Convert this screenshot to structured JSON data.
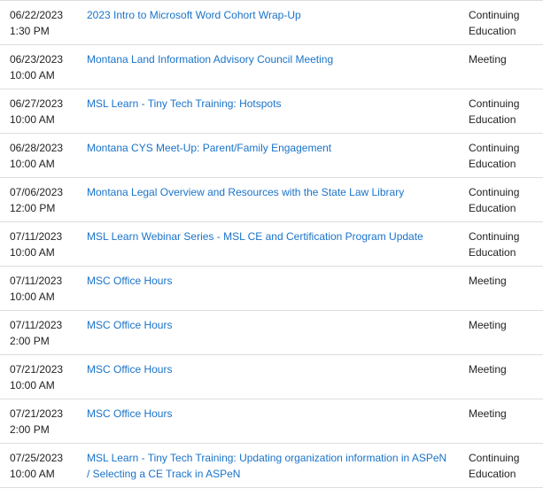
{
  "events": [
    {
      "date": "06/22/2023",
      "time": "1:30 PM",
      "title": "2023 Intro to Microsoft Word Cohort Wrap-Up",
      "type": "Continuing Education"
    },
    {
      "date": "06/23/2023",
      "time": "10:00 AM",
      "title": "Montana Land Information Advisory Council Meeting",
      "type": "Meeting"
    },
    {
      "date": "06/27/2023",
      "time": "10:00 AM",
      "title": "MSL Learn - Tiny Tech Training: Hotspots",
      "type": "Continuing Education"
    },
    {
      "date": "06/28/2023",
      "time": "10:00 AM",
      "title": "Montana CYS Meet-Up: Parent/Family Engagement",
      "type": "Continuing Education"
    },
    {
      "date": "07/06/2023",
      "time": "12:00 PM",
      "title": "Montana Legal Overview and Resources with the State Law Library",
      "type": "Continuing Education"
    },
    {
      "date": "07/11/2023",
      "time": "10:00 AM",
      "title": "MSL Learn Webinar Series - MSL CE and Certification Program Update",
      "type": "Continuing Education"
    },
    {
      "date": "07/11/2023",
      "time": "10:00 AM",
      "title": "MSC Office Hours",
      "type": "Meeting"
    },
    {
      "date": "07/11/2023",
      "time": "2:00 PM",
      "title": "MSC Office Hours",
      "type": "Meeting"
    },
    {
      "date": "07/21/2023",
      "time": "10:00 AM",
      "title": "MSC Office Hours",
      "type": "Meeting"
    },
    {
      "date": "07/21/2023",
      "time": "2:00 PM",
      "title": "MSC Office Hours",
      "type": "Meeting"
    },
    {
      "date": "07/25/2023",
      "time": "10:00 AM",
      "title": "MSL Learn - Tiny Tech Training: Updating organization information in ASPeN / Selecting a CE Track in ASPeN",
      "type": "Continuing Education"
    }
  ]
}
